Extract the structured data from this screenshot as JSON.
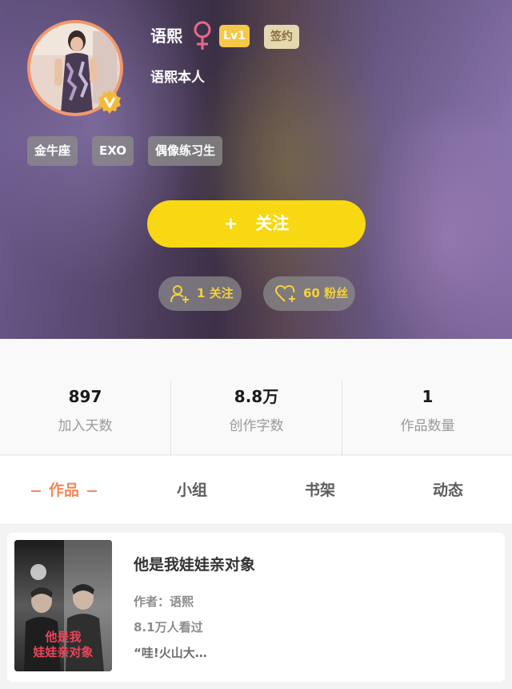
{
  "profile": {
    "username": "语熙",
    "gender_icon": "female-symbol-icon",
    "level": "Lv1",
    "contract_badge": "签约",
    "bio": "语熙本人",
    "verified_icon": "verified-v-badge-icon",
    "tags": [
      "金牛座",
      "EXO",
      "偶像练习生"
    ]
  },
  "actions": {
    "follow_plus": "+",
    "follow_label": "关注",
    "following_count": "1 关注",
    "fans_count": "60 粉丝"
  },
  "stats": [
    {
      "value": "897",
      "label": "加入天数"
    },
    {
      "value": "8.8万",
      "label": "创作字数"
    },
    {
      "value": "1",
      "label": "作品数量"
    }
  ],
  "tabs": [
    {
      "label": "作品",
      "active": true
    },
    {
      "label": "小组",
      "active": false
    },
    {
      "label": "书架",
      "active": false
    },
    {
      "label": "动态",
      "active": false
    }
  ],
  "works": [
    {
      "title": "他是我娃娃亲对象",
      "author": "作者：语熙",
      "views": "8.1万人看过",
      "excerpt": "“哇!火山大…",
      "cover_text_line1": "他是我",
      "cover_text_line2": "娃娃亲对象"
    }
  ],
  "colors": {
    "follow_button": "#f7d813",
    "accent_orange": "#f08a5a",
    "avatar_ring": "#f2986a",
    "level_badge": "#f5c84a",
    "pill_text": "#f5d23a"
  }
}
